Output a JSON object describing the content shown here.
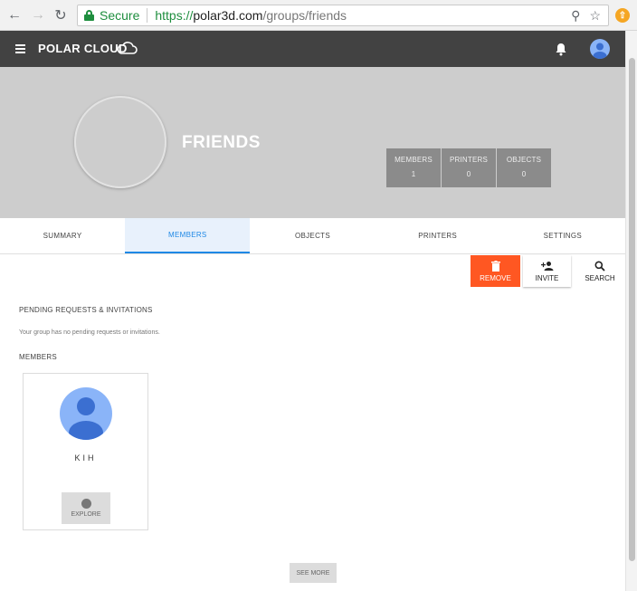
{
  "browser": {
    "secure_label": "Secure",
    "url_proto": "https://",
    "url_host": "polar3d.com",
    "url_path": "/groups/friends"
  },
  "appbar": {
    "brand": "POLAR CLOUD"
  },
  "group": {
    "title": "FRIENDS",
    "stats": [
      {
        "label": "MEMBERS",
        "value": "1"
      },
      {
        "label": "PRINTERS",
        "value": "0"
      },
      {
        "label": "OBJECTS",
        "value": "0"
      }
    ]
  },
  "tabs": [
    "SUMMARY",
    "MEMBERS",
    "OBJECTS",
    "PRINTERS",
    "SETTINGS"
  ],
  "actions": {
    "remove": "REMOVE",
    "invite": "INVITE",
    "search": "SEARCH"
  },
  "pending": {
    "heading": "PENDING REQUESTS & INVITATIONS",
    "empty_text": "Your group has no pending requests or invitations."
  },
  "members": {
    "heading": "MEMBERS",
    "items": [
      {
        "name": "KIH",
        "explore_label": "EXPLORE"
      }
    ],
    "see_more_label": "SEE MORE"
  },
  "colors": {
    "appbar": "#424242",
    "remove": "#ff5722",
    "active_tab": "#1e88e5",
    "secure": "#1e8e3e"
  }
}
